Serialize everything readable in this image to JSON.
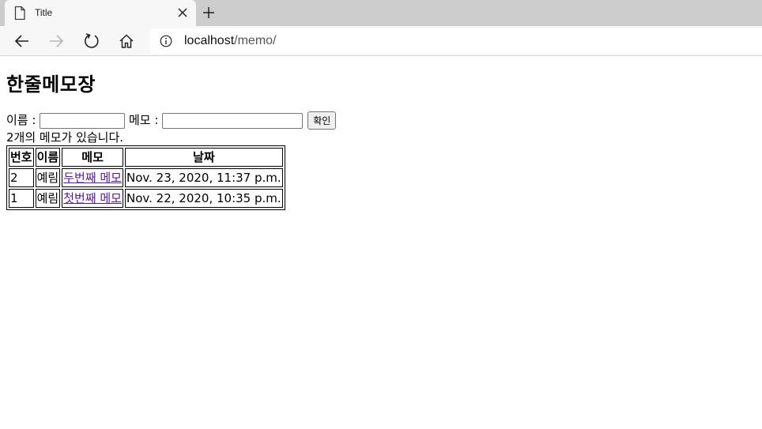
{
  "browser": {
    "tab_title": "Title",
    "url_host": "localhost",
    "url_path": "/memo/"
  },
  "page": {
    "heading": "한줄메모장",
    "form": {
      "name_label": "이름 :",
      "memo_label": "메모 :",
      "submit_label": "확인",
      "name_value": "",
      "memo_value": ""
    },
    "count_text": "2개의 메모가 있습니다.",
    "table": {
      "headers": [
        "번호",
        "이름",
        "메모",
        "날짜"
      ],
      "rows": [
        {
          "num": "2",
          "name": "예림",
          "memo": "두번째 메모",
          "date": "Nov. 23, 2020, 11:37 p.m."
        },
        {
          "num": "1",
          "name": "예림",
          "memo": "첫번째 메모",
          "date": "Nov. 22, 2020, 10:35 p.m."
        }
      ]
    }
  },
  "colors": {
    "visited_link": "#551a8b",
    "tabstrip": "#cccccc",
    "toolbar": "#f7f7f7"
  }
}
